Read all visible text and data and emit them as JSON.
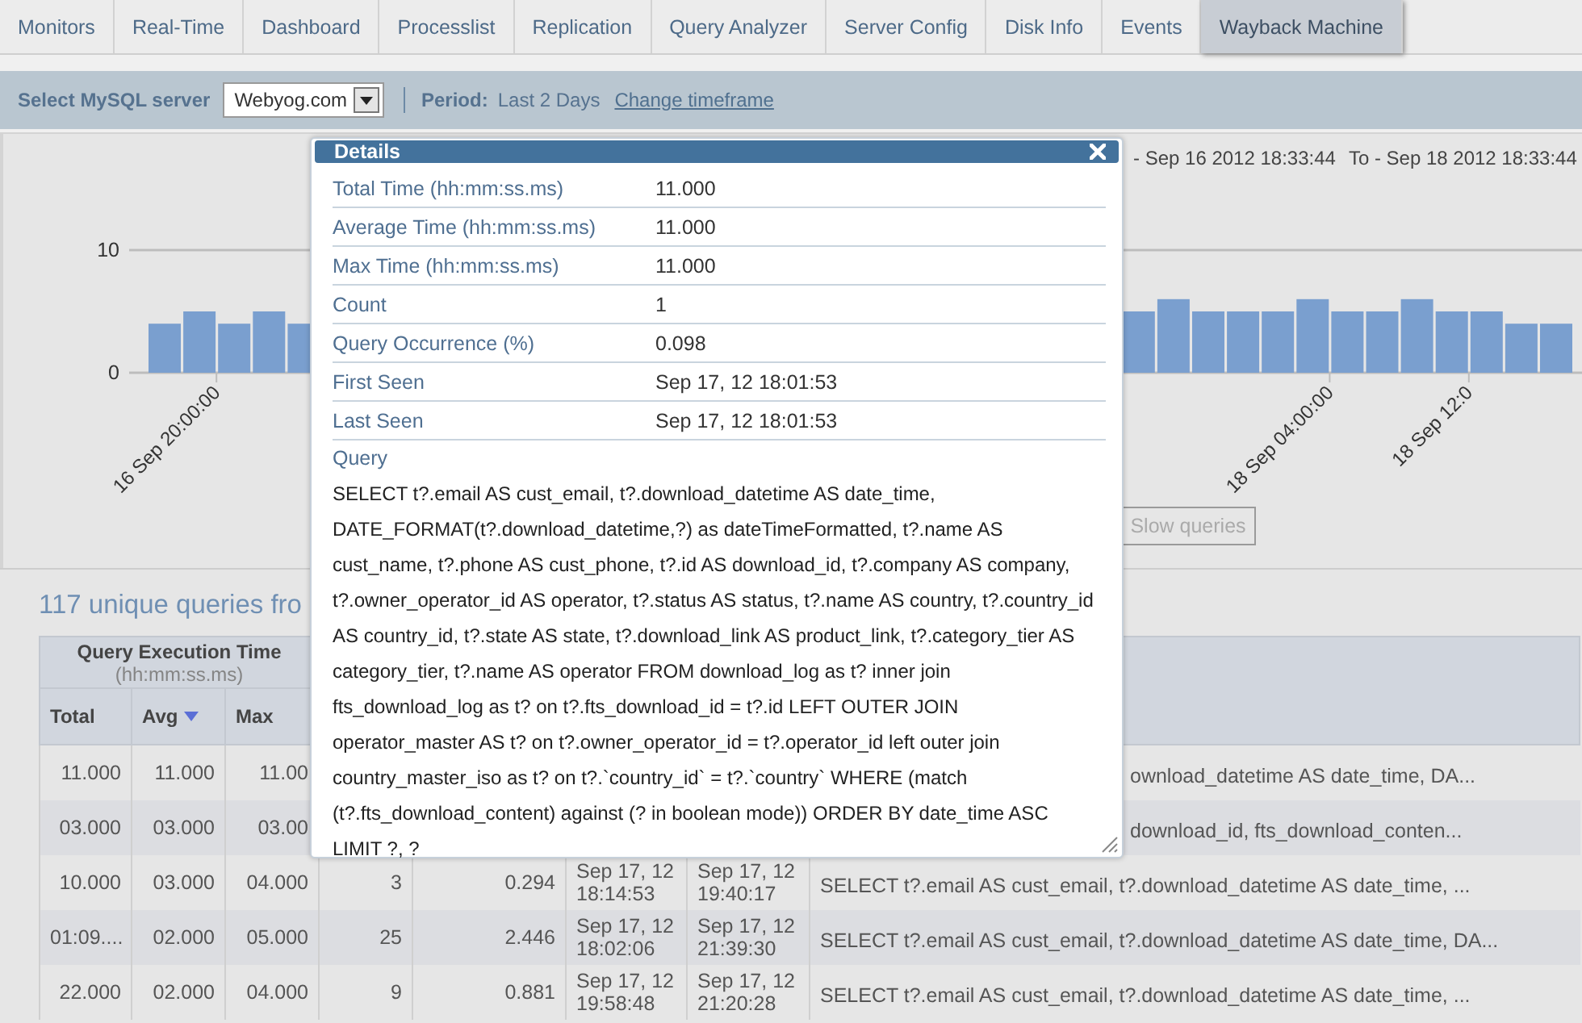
{
  "tabs": [
    {
      "label": "Monitors",
      "selected": false
    },
    {
      "label": "Real-Time",
      "selected": false
    },
    {
      "label": "Dashboard",
      "selected": false
    },
    {
      "label": "Processlist",
      "selected": false
    },
    {
      "label": "Replication",
      "selected": false
    },
    {
      "label": "Query Analyzer",
      "selected": false
    },
    {
      "label": "Server Config",
      "selected": false
    },
    {
      "label": "Disk Info",
      "selected": false
    },
    {
      "label": "Events",
      "selected": false
    },
    {
      "label": "Wayback Machine",
      "selected": true
    }
  ],
  "toolbar": {
    "server_label": "Select MySQL server",
    "server": "Webyog.com",
    "period_label": "Period:",
    "period": "Last 2 Days",
    "change_link": "Change timeframe"
  },
  "chart_panel": {
    "range_from": "- Sep 16 2012 18:33:44",
    "range_to": "To - Sep 18 2012 18:33:44",
    "chart_data": {
      "type": "bar",
      "categories": [
        null,
        null,
        "16 Sep 20:00:00",
        null,
        null,
        null,
        null,
        null,
        null,
        null,
        null,
        null,
        null,
        null,
        null,
        null,
        null,
        null,
        null,
        null,
        null,
        null,
        null,
        null,
        null,
        null,
        null,
        null,
        null,
        null,
        null,
        null,
        null,
        null,
        "18 Sep 04:00:00",
        null,
        null,
        null,
        "18 Sep 12:0",
        null,
        null
      ],
      "values": [
        4,
        5,
        4,
        5,
        4,
        null,
        null,
        null,
        null,
        null,
        null,
        null,
        null,
        null,
        null,
        null,
        null,
        null,
        null,
        null,
        null,
        null,
        null,
        null,
        null,
        null,
        null,
        null,
        5,
        6,
        5,
        5,
        5,
        6,
        5,
        5,
        6,
        5,
        5,
        4,
        4
      ],
      "yticks": [
        0,
        10
      ],
      "ylim": [
        0,
        10
      ]
    },
    "slow_queries_button": "Slow queries"
  },
  "queries": {
    "heading": "117 unique queries fro",
    "table": {
      "group_header": "Query Execution Time",
      "group_subheader": "(hh:mm:ss.ms)",
      "columns": [
        {
          "label": "Total",
          "sorted": false
        },
        {
          "label": "Avg",
          "sorted": true
        },
        {
          "label": "Max",
          "sorted": false
        }
      ],
      "rows": [
        {
          "total": "11.000",
          "avg": "11.000",
          "max": "11.00",
          "query": "ownload_datetime AS date_time, DA..."
        },
        {
          "total": "03.000",
          "avg": "03.000",
          "max": "03.00",
          "query": "download_id, fts_download_conten..."
        },
        {
          "total": "10.000",
          "avg": "03.000",
          "max": "04.000",
          "count": "3",
          "occurrence": "0.294",
          "first_seen": "Sep 17, 12 18:14:53",
          "last_seen": "Sep 17, 12 19:40:17",
          "query": "SELECT t?.email AS cust_email, t?.download_datetime AS date_time, ..."
        },
        {
          "total": "01:09....",
          "avg": "02.000",
          "max": "05.000",
          "count": "25",
          "occurrence": "2.446",
          "first_seen": "Sep 17, 12 18:02:06",
          "last_seen": "Sep 17, 12 21:39:30",
          "query": "SELECT t?.email AS cust_email, t?.download_datetime AS date_time, DA..."
        },
        {
          "total": "22.000",
          "avg": "02.000",
          "max": "04.000",
          "count": "9",
          "occurrence": "0.881",
          "first_seen": "Sep 17, 12 19:58:48",
          "last_seen": "Sep 17, 12 21:20:28",
          "query": "SELECT t?.email AS cust_email, t?.download_datetime AS date_time, ..."
        }
      ]
    }
  },
  "details": {
    "title": "Details",
    "rows": [
      {
        "label": "Total Time (hh:mm:ss.ms)",
        "value": "11.000"
      },
      {
        "label": "Average Time (hh:mm:ss.ms)",
        "value": "11.000"
      },
      {
        "label": "Max Time (hh:mm:ss.ms)",
        "value": "11.000"
      },
      {
        "label": "Count",
        "value": "1"
      },
      {
        "label": "Query Occurrence (%)",
        "value": "0.098"
      },
      {
        "label": "First Seen",
        "value": "Sep 17, 12 18:01:53"
      },
      {
        "label": "Last Seen",
        "value": "Sep 17, 12 18:01:53"
      }
    ],
    "query_label": "Query",
    "query": "SELECT t?.email AS cust_email, t?.download_datetime AS date_time, DATE_FORMAT(t?.download_datetime,?) as dateTimeFormatted, t?.name AS cust_name, t?.phone AS cust_phone, t?.id AS download_id, t?.company AS company, t?.owner_operator_id AS operator, t?.status AS status, t?.name AS country, t?.country_id AS country_id, t?.state AS state, t?.download_link AS product_link, t?.category_tier AS category_tier, t?.name AS operator FROM download_log as t? inner join fts_download_log as t? on t?.fts_download_id = t?.id LEFT OUTER JOIN operator_master AS t? on t?.owner_operator_id = t?.operator_id left outer join country_master_iso as t? on t?.`country_id` = t?.`country` WHERE (match (t?.fts_download_content) against (? in boolean mode)) ORDER BY date_time ASC LIMIT ?, ?"
  }
}
